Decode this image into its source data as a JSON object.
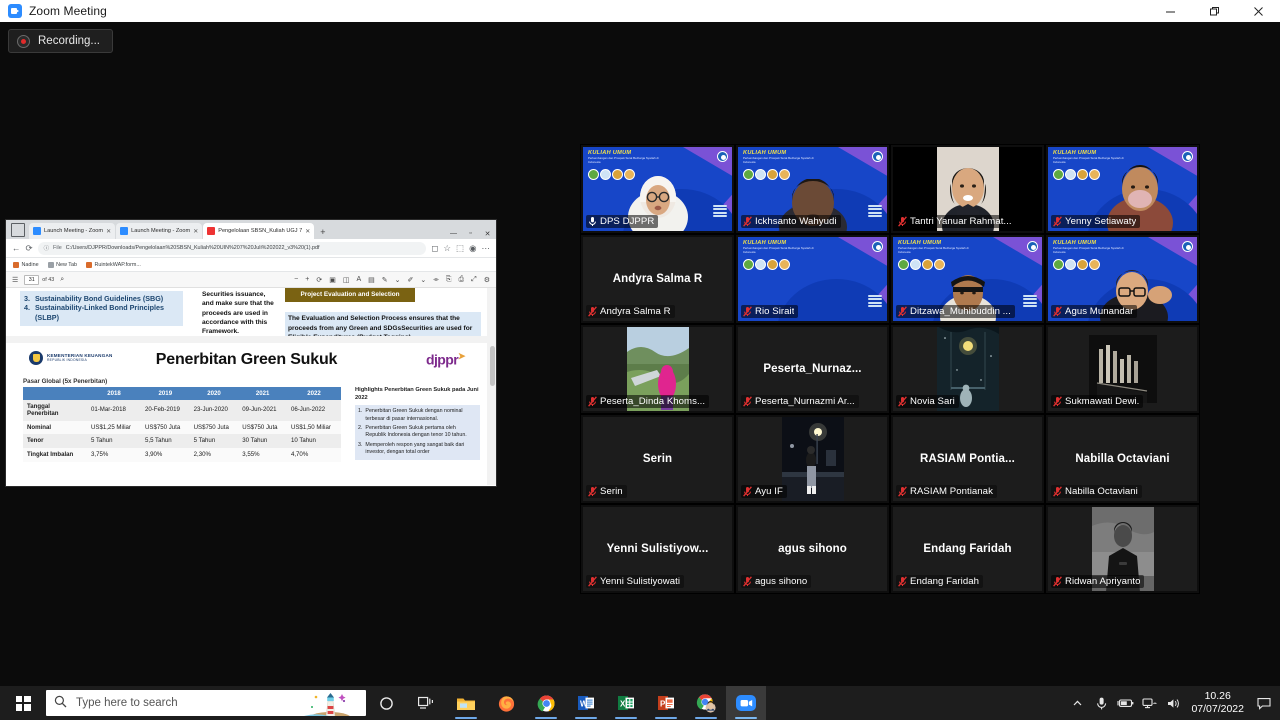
{
  "window": {
    "title": "Zoom Meeting",
    "app_icon": "zoom-camera-icon",
    "minimize": "minimize-icon",
    "restore": "restore-icon",
    "close": "close-icon"
  },
  "recording": {
    "label": "Recording...",
    "icon": "record-dot-icon"
  },
  "shared_screen": {
    "browser": {
      "tabs": [
        {
          "title": "Launch Meeting - Zoom",
          "favicon": "zoom-icon",
          "active": false
        },
        {
          "title": "Launch Meeting - Zoom",
          "favicon": "zoom-icon",
          "active": false
        },
        {
          "title": "Pengelolaan SBSN_Kuliah UGJ 7",
          "favicon": "pdf-icon",
          "active": true
        }
      ],
      "new_tab": "+",
      "nav": {
        "back": "back-arrow-icon",
        "reload": "reload-icon"
      },
      "url_label": "File",
      "url": "C:/Users/DJPPR/Downloads/Pengelolaan%20SBSN_Kuliah%20UIN%207%20Juli%202022_v3%20(1).pdf",
      "bookmarks": [
        "Nadine",
        "New Tab",
        "RuintekWAP.form..."
      ],
      "window_controls": {
        "minimize": "minimize-icon",
        "maximize": "maximize-icon",
        "close": "close-icon"
      }
    },
    "pdf_toolbar": {
      "sidebar_icon": "page-thumbnails-icon",
      "page_current": "31",
      "page_of": "of 43",
      "search_icon": "search-icon",
      "zoom_out": "minus-icon",
      "zoom_in": "plus-icon",
      "rotate": "rotate-icon",
      "fit": "fit-page-icon",
      "read_aloud": "read-aloud-icon",
      "draw": "draw-icon",
      "highlight": "highlight-icon",
      "erase": "erase-icon",
      "save": "save-icon",
      "print": "print-icon",
      "fullscreen": "fullscreen-icon",
      "settings": "settings-icon"
    },
    "prev_slide": {
      "list_items": [
        {
          "num": "3.",
          "text": "Sustainability Bond Guidelines (SBG)"
        },
        {
          "num": "4.",
          "text": "Sustainability-Linked Bond Principles (SLBP)"
        }
      ],
      "middle_text": "Securities issuance, and make sure that the proceeds are used in accordance with this Framework.",
      "badge": "Project Evaluation and Selection",
      "body_text": "The Evaluation and Selection Process ensures that the proceeds from any Green and SDGsSecurities are used for Eligible Expenditures (Budget Tagging)."
    },
    "slide": {
      "ministry_line1": "KEMENTERIAN KEUANGAN",
      "ministry_line2": "REPUBLIK INDONESIA",
      "title": "Penerbitan Green Sukuk",
      "brand": "djppr",
      "subtitle": "Pasar Global (5x Penerbitan)",
      "table": {
        "headers": [
          "",
          "2018",
          "2019",
          "2020",
          "2021",
          "2022"
        ],
        "rows": [
          {
            "label": "Tanggal Penerbitan",
            "values": [
              "01-Mar-2018",
              "20-Feb-2019",
              "23-Jun-2020",
              "09-Jun-2021",
              "06-Jun-2022"
            ]
          },
          {
            "label": "Nominal",
            "values": [
              "US$1,25 Miliar",
              "US$750 Juta",
              "US$750 Juta",
              "US$750 Juta",
              "US$1,50 Miliar"
            ]
          },
          {
            "label": "Tenor",
            "values": [
              "5 Tahun",
              "5,5 Tahun",
              "5 Tahun",
              "30 Tahun",
              "10 Tahun"
            ]
          },
          {
            "label": "Tingkat Imbalan",
            "values": [
              "3,75%",
              "3,90%",
              "2,30%",
              "3,55%",
              "4,70%"
            ]
          }
        ]
      },
      "highlights": {
        "title": "Highlights Penerbitan Green Sukuk pada Juni 2022",
        "items": [
          {
            "num": "1.",
            "text": "Penerbitan Green Sukuk dengan nominal terbesar di pasar internasional."
          },
          {
            "num": "2.",
            "text": "Penerbitan Green Sukuk pertama oleh Republik Indonesia dengan tenor 10 tahun."
          },
          {
            "num": "3.",
            "text": "Memperoleh respon yang sangat baik dari investor, dengan total order"
          }
        ]
      }
    }
  },
  "virtual_background": {
    "title": "KULIAH UMUM",
    "subtitle": "Perkembangan dan Prospek Surat Berharga Syariah di Indonesia"
  },
  "participants": [
    {
      "name": "DPS DJPPR",
      "display_name": "DPS DJPPR",
      "muted": false,
      "active_speaker": true,
      "video": "virtual-bg",
      "avatar": "none"
    },
    {
      "name": "Ickhsanto Wahyudi",
      "display_name": "Ickhsanto Wahyudi",
      "muted": true,
      "active_speaker": false,
      "video": "virtual-bg",
      "avatar": "none"
    },
    {
      "name": "Tantri Yanuar Rahmat...",
      "display_name": "Tantri Yanuar Rahmat...",
      "muted": true,
      "active_speaker": false,
      "video": "photo",
      "avatar": "none"
    },
    {
      "name": "Yenny Setiawaty",
      "display_name": "Yenny Setiawaty",
      "muted": true,
      "active_speaker": false,
      "video": "virtual-bg",
      "avatar": "none"
    },
    {
      "name": "Andyra Salma R",
      "display_name": "Andyra Salma R",
      "muted": true,
      "active_speaker": false,
      "video": "off",
      "avatar": "name"
    },
    {
      "name": "Rio Sirait",
      "display_name": "Rio Sirait",
      "muted": true,
      "active_speaker": false,
      "video": "virtual-bg",
      "avatar": "none"
    },
    {
      "name": "Ditzawa_Muhibuddin ...",
      "display_name": "Ditzawa_Muhibuddin ...",
      "muted": true,
      "active_speaker": false,
      "video": "virtual-bg",
      "avatar": "none"
    },
    {
      "name": "Agus Munandar",
      "display_name": "Agus Munandar",
      "muted": true,
      "active_speaker": false,
      "video": "virtual-bg",
      "avatar": "none"
    },
    {
      "name": "Peserta_Dinda Khoms...",
      "display_name": "Peserta_Dinda Khoms...",
      "muted": true,
      "active_speaker": false,
      "video": "photo",
      "avatar": "none"
    },
    {
      "name": "Peserta_Nurnazmi Ar...",
      "display_name": "Peserta_Nurnazmi Ar...",
      "muted": true,
      "active_speaker": false,
      "video": "off",
      "avatar": "name",
      "center_label": "Peserta_Nurnaz..."
    },
    {
      "name": "Novia Sari",
      "display_name": "Novia Sari",
      "muted": true,
      "active_speaker": false,
      "video": "photo",
      "avatar": "none"
    },
    {
      "name": "Sukmawati Dewi.",
      "display_name": "Sukmawati Dewi.",
      "muted": true,
      "active_speaker": false,
      "video": "photo",
      "avatar": "none"
    },
    {
      "name": "Serin",
      "display_name": "Serin",
      "muted": true,
      "active_speaker": false,
      "video": "off",
      "avatar": "name"
    },
    {
      "name": "Ayu IF",
      "display_name": "Ayu IF",
      "muted": true,
      "active_speaker": false,
      "video": "photo",
      "avatar": "none"
    },
    {
      "name": "RASIAM Pontianak",
      "display_name": "RASIAM Pontianak",
      "muted": true,
      "active_speaker": false,
      "video": "off",
      "avatar": "name",
      "center_label": "RASIAM  Pontia..."
    },
    {
      "name": "Nabilla Octaviani",
      "display_name": "Nabilla Octaviani",
      "muted": true,
      "active_speaker": false,
      "video": "off",
      "avatar": "name"
    },
    {
      "name": "Yenni Sulistiyowati",
      "display_name": "Yenni Sulistiyowati",
      "muted": true,
      "active_speaker": false,
      "video": "off",
      "avatar": "name",
      "center_label": "Yenni  Sulistiyow..."
    },
    {
      "name": "agus sihono",
      "display_name": "agus sihono",
      "muted": true,
      "active_speaker": false,
      "video": "off",
      "avatar": "name"
    },
    {
      "name": "Endang Faridah",
      "display_name": "Endang Faridah",
      "muted": true,
      "active_speaker": false,
      "video": "off",
      "avatar": "name"
    },
    {
      "name": "Ridwan Apriyanto",
      "display_name": "Ridwan Apriyanto",
      "muted": true,
      "active_speaker": false,
      "video": "photo",
      "avatar": "none"
    }
  ],
  "taskbar": {
    "start": "windows-logo-icon",
    "search_placeholder": "Type here to search",
    "search_icon": "search-icon",
    "cortana": "cortana-icon",
    "task_view": "task-view-icon",
    "apps": [
      {
        "name": "file-explorer-icon",
        "open": true
      },
      {
        "name": "firefox-icon",
        "open": false
      },
      {
        "name": "chrome-icon",
        "open": true
      },
      {
        "name": "word-icon",
        "open": true
      },
      {
        "name": "excel-icon",
        "open": true
      },
      {
        "name": "powerpoint-icon",
        "open": true
      },
      {
        "name": "chrome-profile-icon",
        "open": true
      },
      {
        "name": "zoom-icon",
        "open": true,
        "selected": true
      }
    ],
    "tray": {
      "chevron": "show-hidden-icons",
      "microphone": "microphone-icon",
      "battery": "battery-icon",
      "network": "network-icon",
      "volume": "volume-icon",
      "time": "10.26",
      "date": "07/07/2022",
      "action_center": "action-center-icon"
    }
  },
  "colors": {
    "accent": "#2D8CFF",
    "active_speaker_border": "#f3e96a",
    "muted_red": "#e03030",
    "taskbar": "#1d1d1d",
    "table_header": "#4a81bd",
    "highlight_box": "#dfe7f4"
  }
}
